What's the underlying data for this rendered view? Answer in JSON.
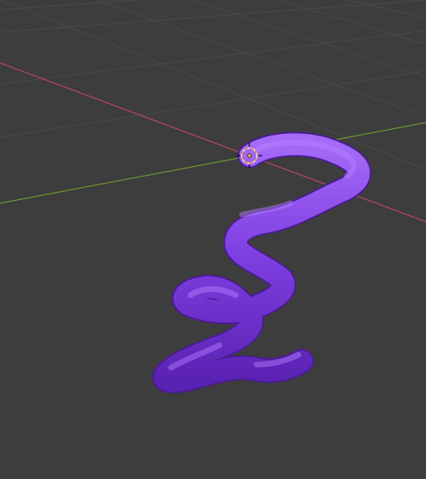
{
  "viewport": {
    "background": "#3d3d3d",
    "grid_color": "#4a4a4a",
    "x_axis_color": "#c2475f",
    "y_axis_color": "#6f9a2f"
  },
  "object": {
    "type": "curve-tube",
    "color_light": "#9a5cf0",
    "color_mid": "#7e3fe0",
    "color_dark": "#5c25b0"
  },
  "icons": {
    "origin": "origin-point-icon",
    "cursor": "3d-cursor-icon"
  }
}
